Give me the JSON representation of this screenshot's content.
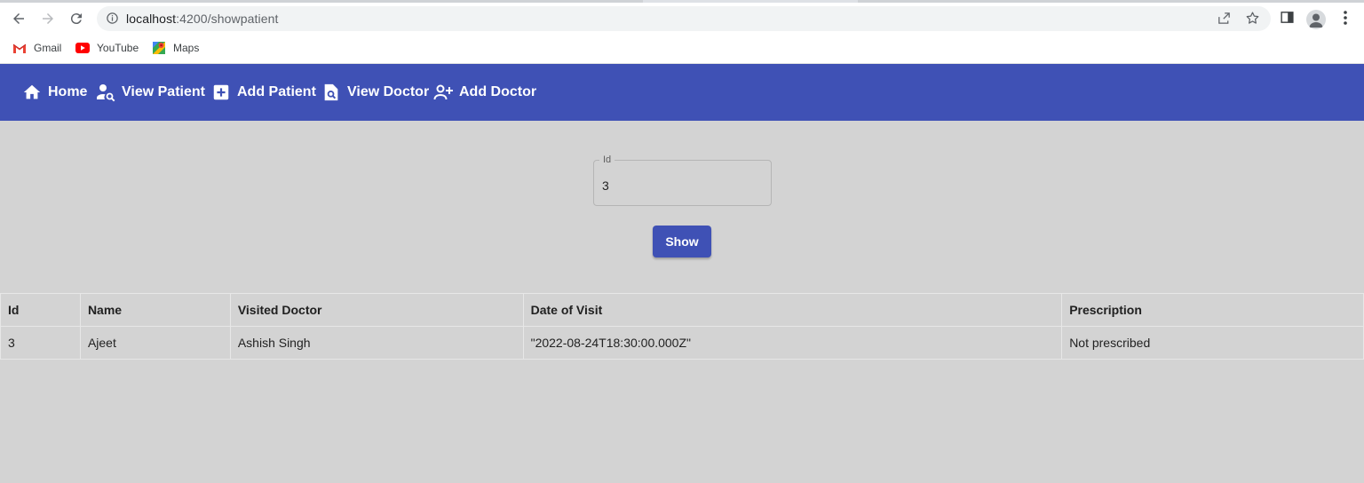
{
  "browser": {
    "url_host": "localhost",
    "url_path": ":4200/showpatient",
    "bookmarks": [
      {
        "label": "Gmail",
        "icon": "gmail-icon"
      },
      {
        "label": "YouTube",
        "icon": "youtube-icon"
      },
      {
        "label": "Maps",
        "icon": "maps-icon"
      }
    ]
  },
  "nav": {
    "items": [
      {
        "label": "Home",
        "icon": "home-icon"
      },
      {
        "label": "View Patient",
        "icon": "person-search-icon"
      },
      {
        "label": "Add Patient",
        "icon": "add-box-icon"
      },
      {
        "label": "View Doctor",
        "icon": "find-in-page-icon"
      },
      {
        "label": "Add Doctor",
        "icon": "person-add-icon"
      }
    ]
  },
  "form": {
    "id_label": "Id",
    "id_value": "3",
    "show_label": "Show"
  },
  "table": {
    "headers": [
      "Id",
      "Name",
      "Visited Doctor",
      "Date of Visit",
      "Prescription"
    ],
    "rows": [
      [
        "3",
        "Ajeet",
        "Ashish Singh",
        "\"2022-08-24T18:30:00.000Z\"",
        "Not prescribed"
      ]
    ]
  },
  "colors": {
    "primary": "#3f51b5",
    "page_bg": "#d3d3d3"
  }
}
